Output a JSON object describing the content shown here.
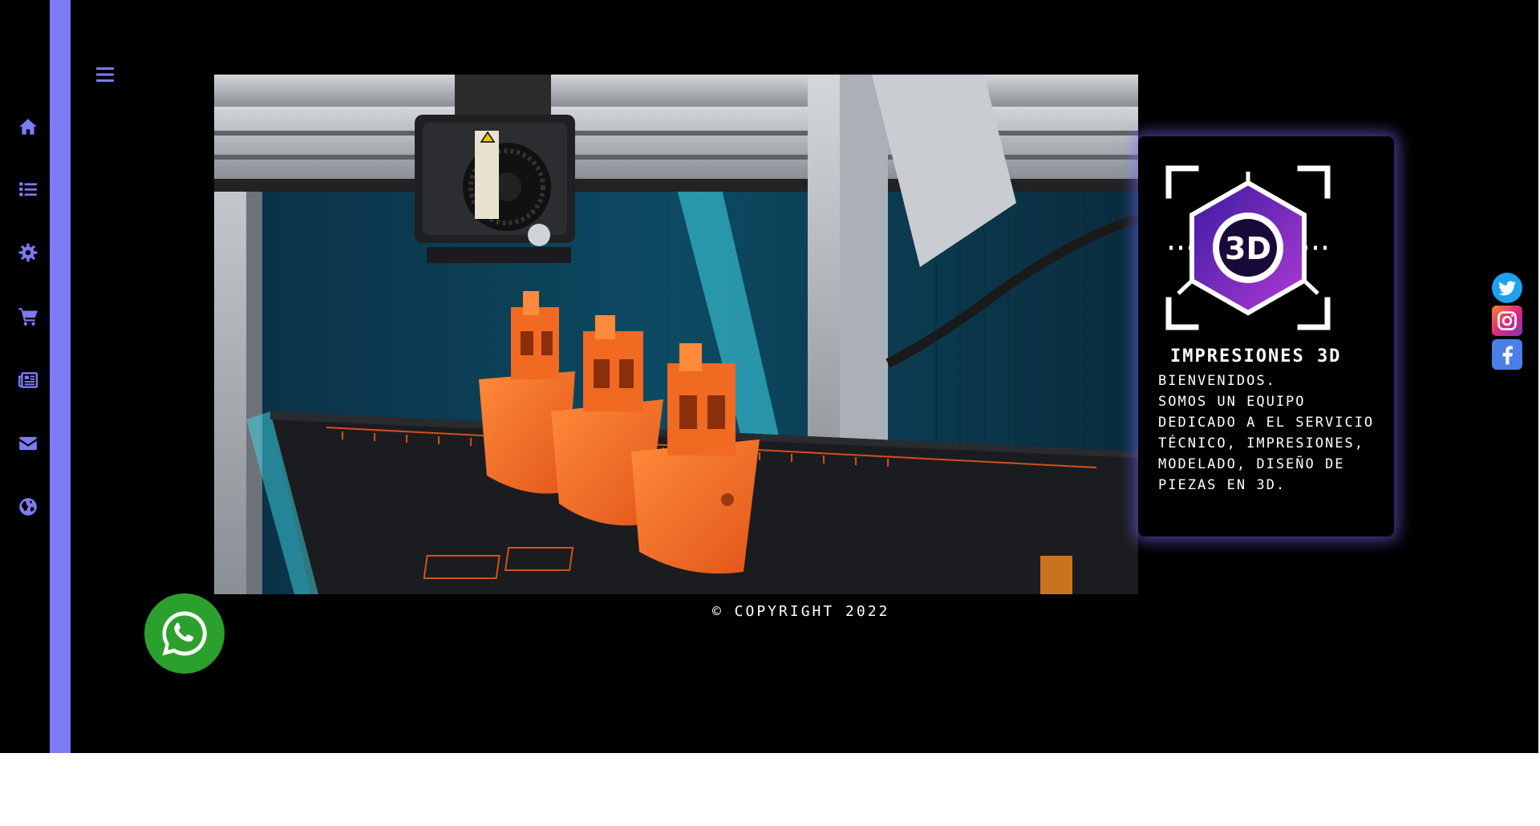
{
  "nav": {
    "menu_icon": "bars-icon",
    "items": [
      {
        "icon": "home-icon"
      },
      {
        "icon": "list-icon"
      },
      {
        "icon": "gear-icon"
      },
      {
        "icon": "cart-icon"
      },
      {
        "icon": "newspaper-icon"
      },
      {
        "icon": "envelope-icon"
      },
      {
        "icon": "globe-icon"
      }
    ],
    "accent_color": "#7b7bf5"
  },
  "hero": {
    "image": "3d-printer-printing-orange-boats"
  },
  "card": {
    "logo_text": "3D",
    "title": "Impresiones 3D",
    "greeting": "Bienvenidos.",
    "description": "Somos un equipo dedicado a el servicio técnico, impresiones, modelado, diseño de piezas en 3D."
  },
  "social": [
    {
      "icon": "twitter-icon",
      "color": "#1da1f2"
    },
    {
      "icon": "instagram-icon",
      "color": "#e1306c"
    },
    {
      "icon": "facebook-icon",
      "color": "#4a7fe8"
    }
  ],
  "footer": {
    "copyright": "© Copyright 2022"
  },
  "whatsapp": {
    "icon": "whatsapp-icon",
    "color": "#2ca02c"
  }
}
